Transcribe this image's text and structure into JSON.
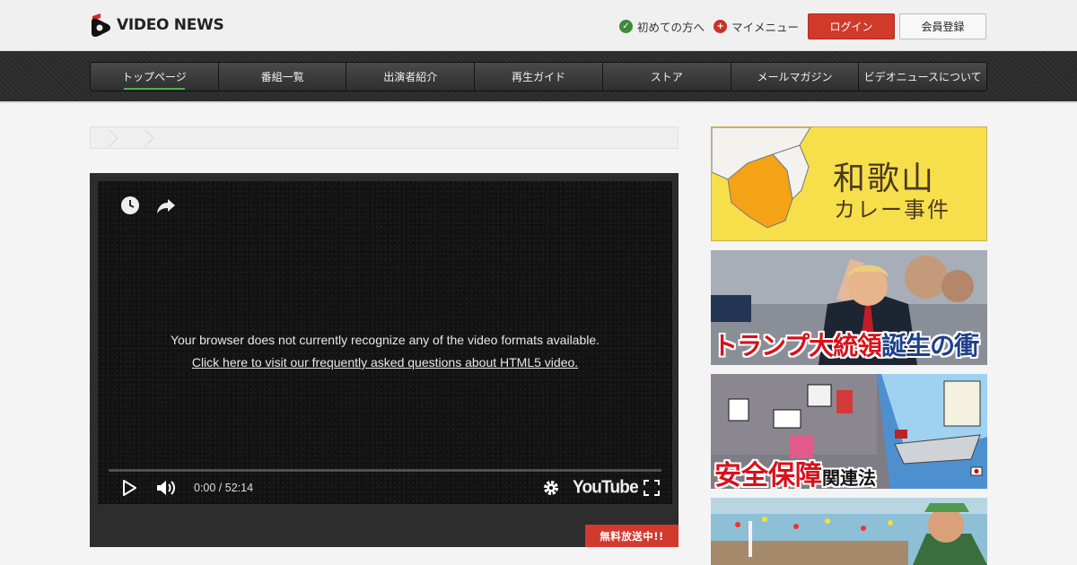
{
  "header": {
    "logo_text": "VIDEO NEWS",
    "links": [
      {
        "label": "初めての方へ",
        "icon": "check-icon"
      },
      {
        "label": "マイメニュー",
        "icon": "plus-icon"
      }
    ],
    "login_label": "ログイン",
    "register_label": "会員登録"
  },
  "nav": {
    "items": [
      {
        "label": "トップページ",
        "active": true
      },
      {
        "label": "番組一覧"
      },
      {
        "label": "出演者紹介"
      },
      {
        "label": "再生ガイド"
      },
      {
        "label": "ストア"
      },
      {
        "label": "メールマガジン"
      },
      {
        "label": "ビデオニュースについて"
      }
    ]
  },
  "player": {
    "message": "Your browser does not currently recognize any of the video formats available.",
    "faq_link": "Click here to visit our frequently asked questions about HTML5 video.",
    "time": "0:00 / 52:14",
    "youtube_label": "YouTube",
    "progress": 0,
    "free_badge": "無料放送中!!"
  },
  "sidebar": {
    "banners": [
      {
        "title": "和歌山",
        "subtitle": "カレー事件",
        "color": "#f6df4a"
      },
      {
        "title_red": "トランプ大統領",
        "title_blue": "誕生の衝撃"
      },
      {
        "title_big": "安全保障",
        "title_small": "関連法"
      },
      {}
    ]
  },
  "colors": {
    "accent_red": "#d03a2b",
    "nav_active_underline": "#4caf50"
  }
}
